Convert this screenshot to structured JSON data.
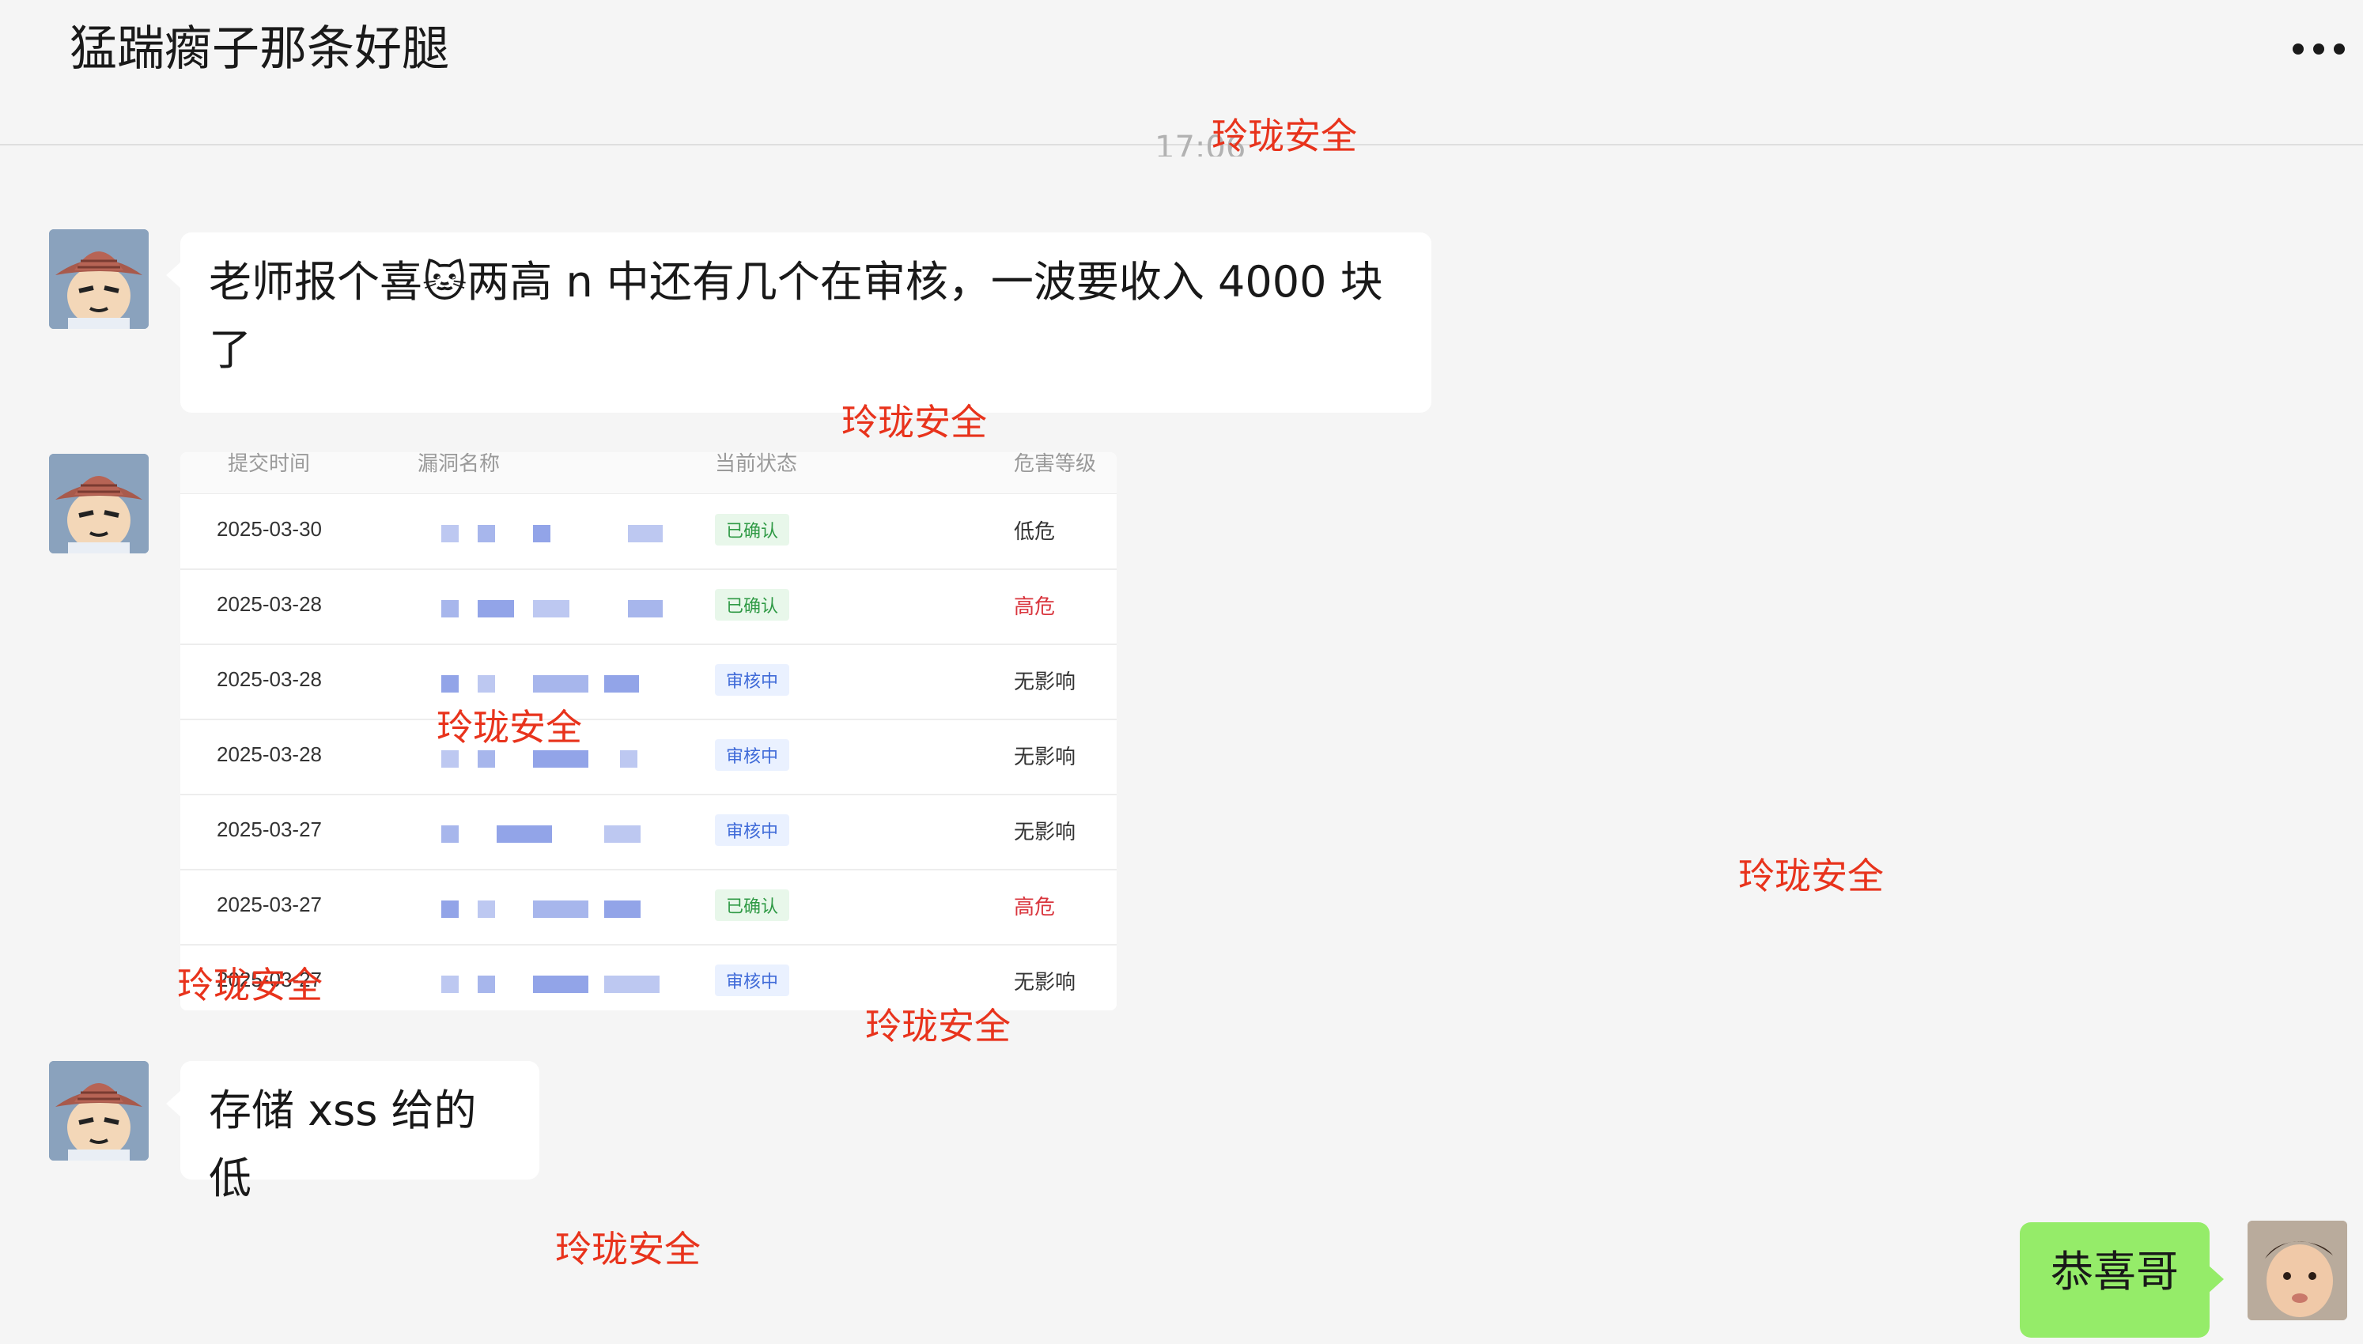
{
  "header": {
    "title": "猛踹瘸子那条好腿",
    "more_icon": "more-dots-icon"
  },
  "timestamp": "17:06",
  "messages": [
    {
      "from": "other",
      "text": "老师报个喜🐱两高 n 中还有几个在审核，一波要收入 4000 块了"
    },
    {
      "from": "other",
      "type": "image"
    },
    {
      "from": "other",
      "text": "存储 xss 给的低"
    },
    {
      "from": "self",
      "text": "恭喜哥"
    }
  ],
  "table_shot": {
    "headers": [
      "提交时间",
      "漏洞名称",
      "当前状态",
      "危害等级"
    ],
    "rows": [
      {
        "date": "2025-03-30",
        "status": "已确认",
        "status_kind": "confirmed",
        "level": "低危",
        "level_kind": "normal"
      },
      {
        "date": "2025-03-28",
        "status": "已确认",
        "status_kind": "confirmed",
        "level": "高危",
        "level_kind": "high"
      },
      {
        "date": "2025-03-28",
        "status": "审核中",
        "status_kind": "review",
        "level": "无影响",
        "level_kind": "normal"
      },
      {
        "date": "2025-03-28",
        "status": "审核中",
        "status_kind": "review",
        "level": "无影响",
        "level_kind": "normal"
      },
      {
        "date": "2025-03-27",
        "status": "审核中",
        "status_kind": "review",
        "level": "无影响",
        "level_kind": "normal"
      },
      {
        "date": "2025-03-27",
        "status": "已确认",
        "status_kind": "confirmed",
        "level": "高危",
        "level_kind": "high"
      },
      {
        "date": "2025-03-27",
        "status": "审核中",
        "status_kind": "review",
        "level": "无影响",
        "level_kind": "normal"
      }
    ]
  },
  "watermark": {
    "text": "玲珑安全",
    "color": "#e8331c"
  },
  "colors": {
    "background": "#f5f5f5",
    "bubble_other": "#ffffff",
    "bubble_self": "#95ec69"
  }
}
